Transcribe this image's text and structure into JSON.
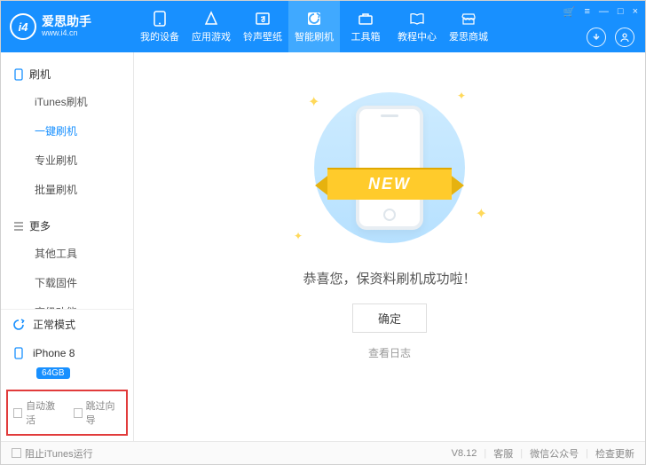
{
  "brand": {
    "name": "爱思助手",
    "url": "www.i4.cn",
    "logo_text": "i4"
  },
  "nav": [
    {
      "label": "我的设备"
    },
    {
      "label": "应用游戏"
    },
    {
      "label": "铃声壁纸"
    },
    {
      "label": "智能刷机",
      "active": true
    },
    {
      "label": "工具箱"
    },
    {
      "label": "教程中心"
    },
    {
      "label": "爱思商城"
    }
  ],
  "window_controls": {
    "cart": "🛒",
    "settings": "≡",
    "min": "—",
    "max": "□",
    "close": "×"
  },
  "sidebar": {
    "groups": [
      {
        "title": "刷机",
        "icon": "phone",
        "items": [
          {
            "label": "iTunes刷机"
          },
          {
            "label": "一键刷机",
            "active": true
          },
          {
            "label": "专业刷机"
          },
          {
            "label": "批量刷机"
          }
        ]
      },
      {
        "title": "更多",
        "icon": "menu",
        "items": [
          {
            "label": "其他工具"
          },
          {
            "label": "下载固件"
          },
          {
            "label": "高级功能"
          }
        ]
      }
    ],
    "status": {
      "mode": "正常模式",
      "device": "iPhone 8",
      "storage": "64GB"
    },
    "checks": {
      "auto_activate": "自动激活",
      "skip_guide": "跳过向导"
    }
  },
  "main": {
    "ribbon": "NEW",
    "success": "恭喜您，保资料刷机成功啦！",
    "ok": "确定",
    "log": "查看日志"
  },
  "footer": {
    "block_itunes": "阻止iTunes运行",
    "version": "V8.12",
    "links": [
      "客服",
      "微信公众号",
      "检查更新"
    ]
  }
}
